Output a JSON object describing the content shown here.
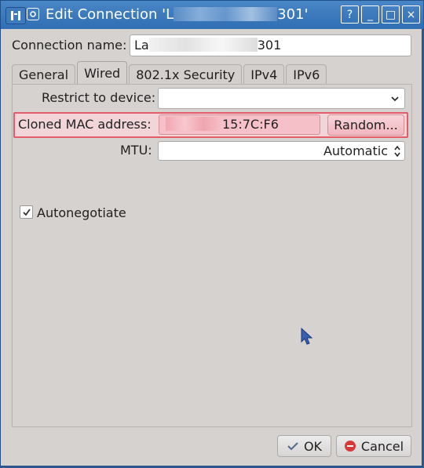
{
  "window": {
    "title_prefix": "Edit Connection 'L",
    "title_suffix": "301'",
    "buttons": {
      "help": "?",
      "minimize": "_",
      "maximize": "□",
      "close": "×"
    }
  },
  "connection": {
    "label": "Connection name:",
    "value_prefix": "La",
    "value_suffix": "301"
  },
  "tabs": [
    "General",
    "Wired",
    "802.1x Security",
    "IPv4",
    "IPv6"
  ],
  "wired": {
    "restrict_label": "Restrict to device:",
    "restrict_value": "",
    "cloned_mac_label": "Cloned MAC address:",
    "cloned_mac_value_visible": "15:7C:F6",
    "random_button": "Random...",
    "mtu_label": "MTU:",
    "mtu_value": "Automatic",
    "autonegotiate_label": "Autonegotiate",
    "autonegotiate_checked": true
  },
  "footer": {
    "ok": "OK",
    "cancel": "Cancel"
  },
  "colors": {
    "titlebar": "#3573b7",
    "highlight": "#e45c67",
    "highlight_bg": "#f1d5d8",
    "window_bg": "#d6d2d0"
  },
  "icons": {
    "app": "network-icon",
    "window": "window-menu-icon",
    "dropdown": "chevron-down-icon",
    "spin": "spin-arrows-icon",
    "check": "check-icon",
    "ok": "check-circle-icon",
    "cancel": "no-entry-icon",
    "cursor": "mouse-pointer-icon"
  }
}
